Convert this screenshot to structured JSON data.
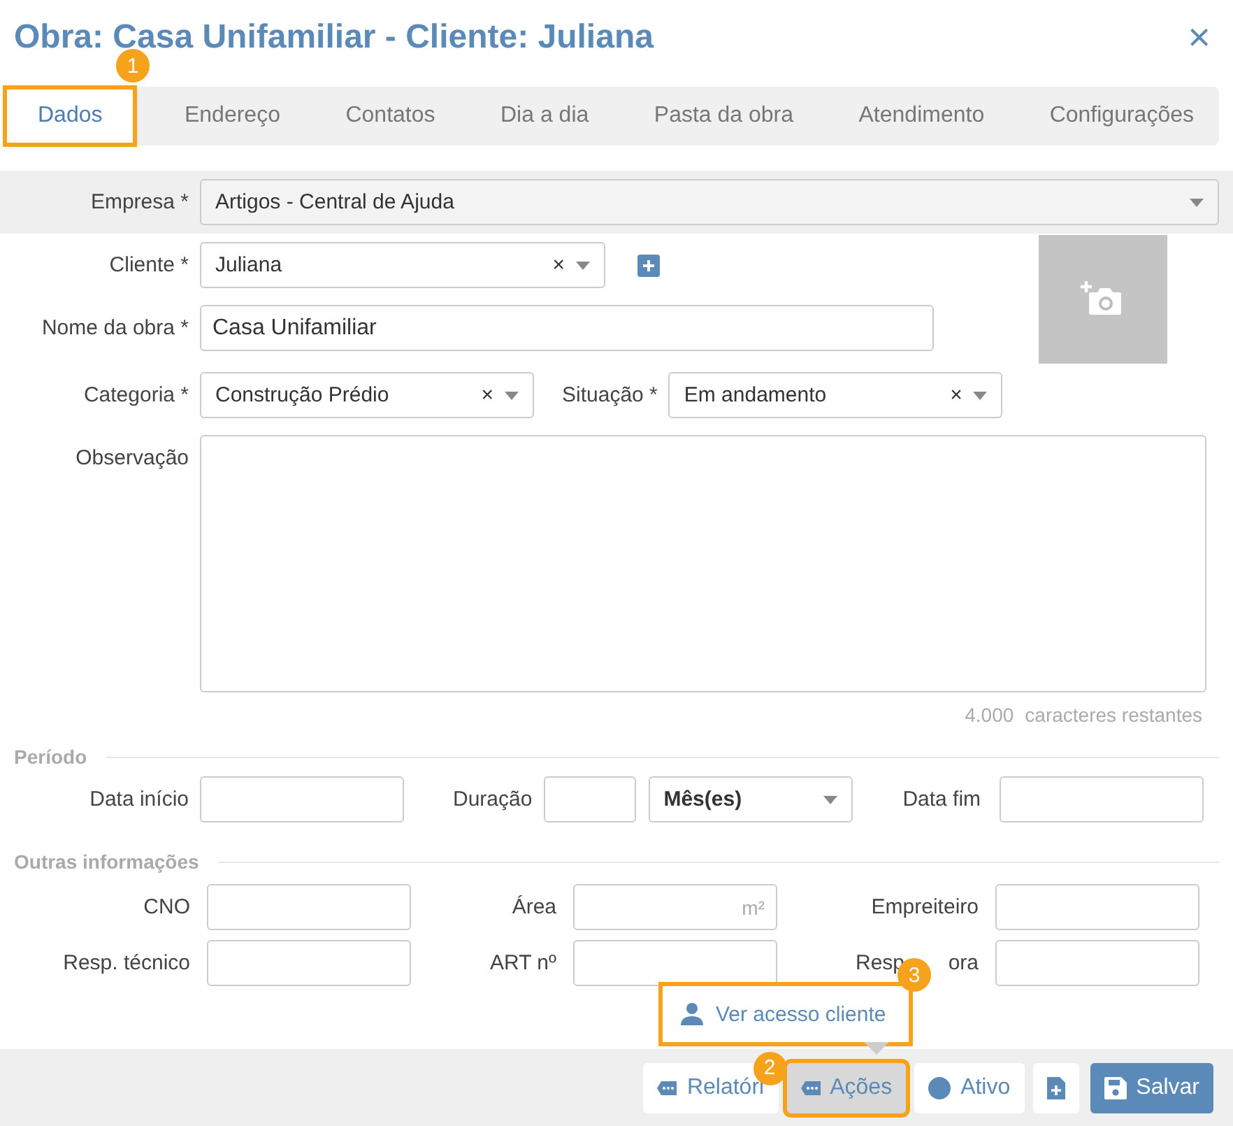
{
  "dialog": {
    "title": "Obra: Casa Unifamiliar - Cliente: Juliana",
    "close": "×"
  },
  "tabs": [
    {
      "label": "Dados",
      "selected": true,
      "callout": "1"
    },
    {
      "label": "Endereço",
      "selected": false
    },
    {
      "label": "Contatos",
      "selected": false
    },
    {
      "label": "Dia a dia",
      "selected": false
    },
    {
      "label": "Pasta da obra",
      "selected": false
    },
    {
      "label": "Atendimento",
      "selected": false
    },
    {
      "label": "Configurações",
      "selected": false
    }
  ],
  "empresa": {
    "label": "Empresa *",
    "value": "Artigos - Central de Ajuda"
  },
  "cliente": {
    "label": "Cliente *",
    "value": "Juliana",
    "clear": "×"
  },
  "nome": {
    "label": "Nome da obra *",
    "value": "Casa Unifamiliar"
  },
  "categoria": {
    "label": "Categoria *",
    "value": "Construção Prédio",
    "clear": "×"
  },
  "situacao": {
    "label": "Situação *",
    "value": "Em andamento",
    "clear": "×"
  },
  "observacao": {
    "label": "Observação",
    "counter_number": "4.000",
    "counter_text": "caracteres restantes"
  },
  "periodo": {
    "heading": "Período",
    "data_inicio": "Data início",
    "duracao": "Duração",
    "unit": "Mês(es)",
    "data_fim": "Data fim"
  },
  "outras": {
    "heading": "Outras informações",
    "cno": "CNO",
    "area": "Área",
    "area_unit": "m²",
    "empreiteiro": "Empreiteiro",
    "resp_tecnico": "Resp. técnico",
    "art": "ART nº",
    "label_6_parts": [
      "Resp",
      "ora"
    ]
  },
  "popup": {
    "label": "Ver acesso cliente",
    "callout": "3"
  },
  "footer": [
    {
      "kind": "tag",
      "label": "Relatóri",
      "highlighted": false
    },
    {
      "kind": "tag",
      "label": "Ações",
      "highlighted": true,
      "callout": "2"
    },
    {
      "kind": "dot",
      "label": "Ativo",
      "highlighted": false
    },
    {
      "kind": "file",
      "highlighted": false
    },
    {
      "kind": "save",
      "label": "Salvar",
      "highlighted": false
    }
  ]
}
